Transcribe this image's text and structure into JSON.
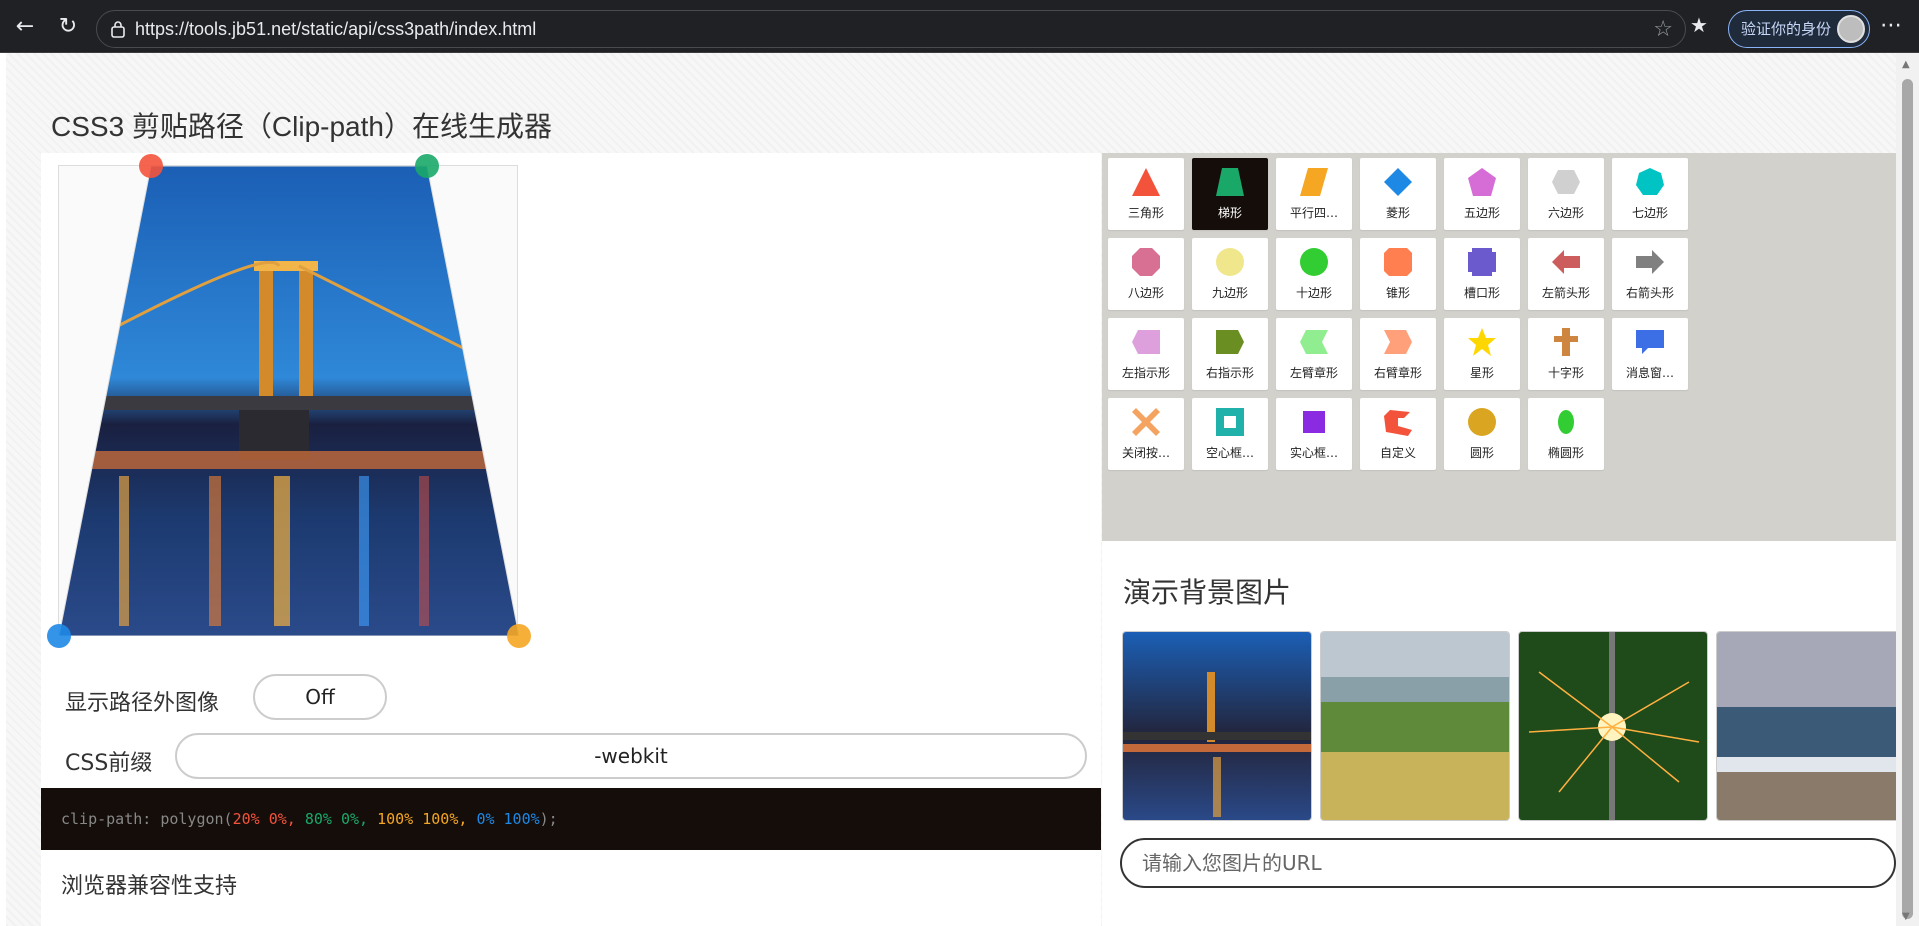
{
  "browser": {
    "url": "https://tools.jb51.net/static/api/css3path/index.html",
    "verify_label": "验证你的身份"
  },
  "page": {
    "title": "CSS3 剪贴路径（Clip-path）在线生成器",
    "show_outside_label": "显示路径外图像",
    "toggle_value": "Off",
    "prefix_label": "CSS前缀",
    "prefix_value": "-webkit",
    "code": {
      "fn": "clip-path: polygon(",
      "p1": "20% 0%, ",
      "p2": "80% 0%, ",
      "p3": "100% 100%, ",
      "p4": "0% 100%",
      "end": ");"
    },
    "compat_heading": "浏览器兼容性支持",
    "bg_title": "演示背景图片",
    "url_placeholder": "请输入您图片的URL"
  },
  "shapes": [
    {
      "label": "三角形",
      "icon": "triangle-icon",
      "color": "#f4533b"
    },
    {
      "label": "梯形",
      "icon": "trapezoid-icon",
      "color": "#1aa869",
      "active": true
    },
    {
      "label": "平行四…",
      "icon": "parallelogram-icon",
      "color": "#f5a623"
    },
    {
      "label": "菱形",
      "icon": "rhombus-icon",
      "color": "#1e88e5"
    },
    {
      "label": "五边形",
      "icon": "pentagon-icon",
      "color": "#d66cd6"
    },
    {
      "label": "六边形",
      "icon": "hexagon-icon",
      "color": "#d0d0d0"
    },
    {
      "label": "七边形",
      "icon": "heptagon-icon",
      "color": "#00c4c4"
    },
    {
      "label": "八边形",
      "icon": "octagon-icon",
      "color": "#d87093"
    },
    {
      "label": "九边形",
      "icon": "nonagon-icon",
      "color": "#f0e68c"
    },
    {
      "label": "十边形",
      "icon": "decagon-icon",
      "color": "#32cd32"
    },
    {
      "label": "锥形",
      "icon": "bevel-icon",
      "color": "#ff7f50"
    },
    {
      "label": "槽口形",
      "icon": "notch-icon",
      "color": "#6a5acd"
    },
    {
      "label": "左箭头形",
      "icon": "left-arrow-icon",
      "color": "#cd5c5c"
    },
    {
      "label": "右箭头形",
      "icon": "right-arrow-icon",
      "color": "#808080"
    },
    {
      "label": "左指示形",
      "icon": "left-point-icon",
      "color": "#dda0dd"
    },
    {
      "label": "右指示形",
      "icon": "right-point-icon",
      "color": "#6b8e23"
    },
    {
      "label": "左臂章形",
      "icon": "left-chevron-icon",
      "color": "#90ee90"
    },
    {
      "label": "右臂章形",
      "icon": "right-chevron-icon",
      "color": "#ffa07a"
    },
    {
      "label": "星形",
      "icon": "star-icon",
      "color": "#ffd700"
    },
    {
      "label": "十字形",
      "icon": "cross-icon",
      "color": "#cd853f"
    },
    {
      "label": "消息窗…",
      "icon": "message-icon",
      "color": "#3c6ee6"
    },
    {
      "label": "关闭按…",
      "icon": "close-icon",
      "color": "#f4a460"
    },
    {
      "label": "空心框…",
      "icon": "frame-icon",
      "color": "#20b2aa"
    },
    {
      "label": "实心框…",
      "icon": "inset-icon",
      "color": "#8a2be2"
    },
    {
      "label": "自定义",
      "icon": "custom-icon",
      "color": "#f4533b"
    },
    {
      "label": "圆形",
      "icon": "circle-icon",
      "color": "#daa520"
    },
    {
      "label": "椭圆形",
      "icon": "ellipse-icon",
      "color": "#32cd32"
    }
  ],
  "backgrounds": [
    {
      "name": "bridge-thumbnail"
    },
    {
      "name": "countryside-thumbnail"
    },
    {
      "name": "sparkler-thumbnail"
    },
    {
      "name": "ocean-thumbnail"
    }
  ]
}
